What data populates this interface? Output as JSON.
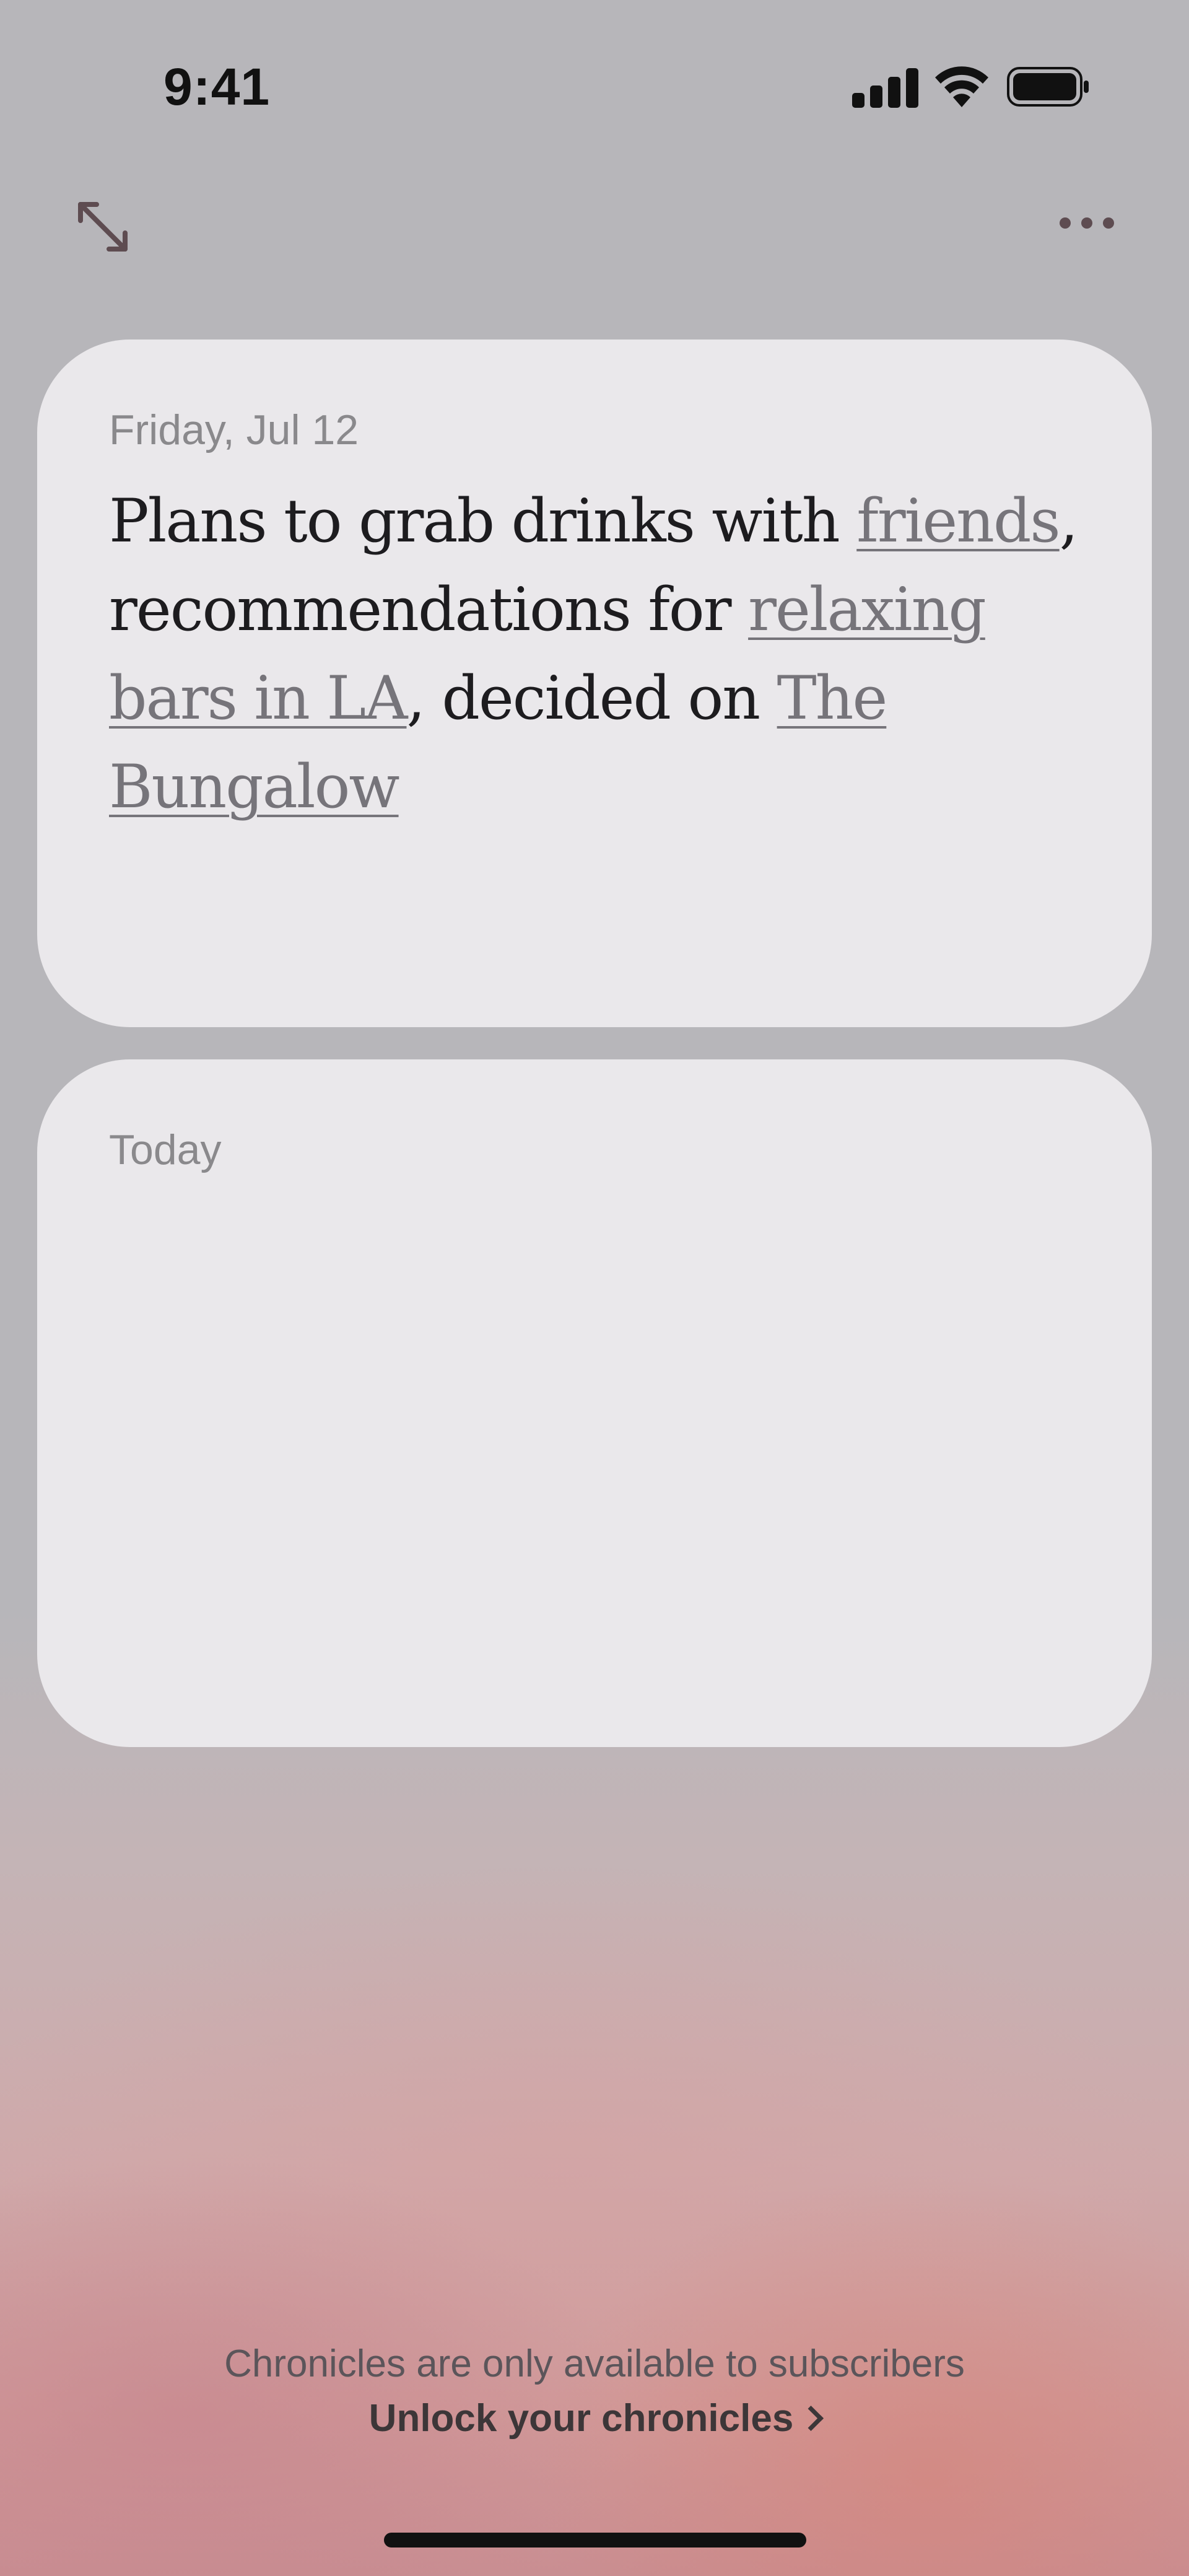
{
  "status_bar": {
    "time": "9:41"
  },
  "toolbar": {
    "expand_icon": "expand-arrows-icon",
    "more_icon": "ellipsis-icon"
  },
  "cards": [
    {
      "date": "Friday, Jul 12",
      "summary_parts": [
        {
          "text": "Plans to grab drinks with ",
          "link": false
        },
        {
          "text": "friends",
          "link": true
        },
        {
          "text": ", recommendations for ",
          "link": false
        },
        {
          "text": "relaxing bars in LA",
          "link": true
        },
        {
          "text": ", decided on ",
          "link": false
        },
        {
          "text": "The Bungalow",
          "link": true
        }
      ]
    },
    {
      "date": "Today",
      "summary_parts": []
    }
  ],
  "footer": {
    "note": "Chronicles are only available to subscribers",
    "unlock_label": "Unlock your chronicles"
  },
  "colors": {
    "card_background": "#eae8eb",
    "link_text": "#76747a",
    "body_text": "#1d1c1f"
  }
}
